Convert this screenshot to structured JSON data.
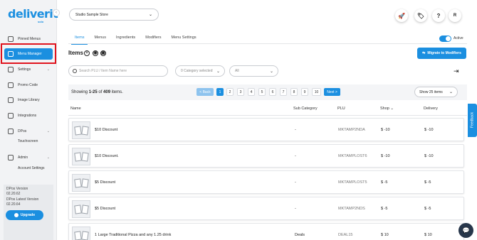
{
  "brand": {
    "logo": "deliverit",
    "sub": "solo",
    "accent": "#1b8fe0"
  },
  "sidebar": {
    "items": [
      {
        "label": "Pinned Menus",
        "icon": "pin-icon"
      },
      {
        "label": "Menu Manager",
        "icon": "menu-icon"
      },
      {
        "label": "Settings",
        "icon": "gear-icon"
      },
      {
        "label": "Promo Code",
        "icon": "ticket-icon"
      },
      {
        "label": "Image Library",
        "icon": "image-icon"
      },
      {
        "label": "Integrations",
        "icon": "link-icon"
      },
      {
        "label": "DPos",
        "icon": "pos-icon"
      },
      {
        "label": "Admin",
        "icon": "user-icon"
      }
    ],
    "sub_touchscreen": "Touchscreen",
    "sub_account_settings": "Account Settings",
    "version": {
      "dpos_label": "DPos Version",
      "dpos_value": "02.20.62",
      "latest_label": "DPos Latest Version",
      "latest_value": "02.20.64"
    },
    "upgrade_label": "Upgrade"
  },
  "header": {
    "store": "Studio Sample Store",
    "buttons": [
      "rocket-icon",
      "tag-icon",
      "help-icon"
    ],
    "avatar": "R"
  },
  "tabs": [
    "Items",
    "Menus",
    "Ingredients",
    "Modifiers",
    "Menu Settings"
  ],
  "active_toggle_label": "Active",
  "items_title": "Items",
  "migrate_label": "Migrate to Modifiers",
  "filters": {
    "search_placeholder": "Search PLU / Item Name here",
    "category": "0 Category selected",
    "type": "All"
  },
  "pagination": {
    "showing_prefix": "Showing ",
    "range": "1-25",
    "of": " of ",
    "total": "409",
    "suffix": " items.",
    "back": "< Back",
    "pages": [
      "1",
      "2",
      "3",
      "4",
      "5",
      "6",
      "7",
      "8",
      "9",
      "10"
    ],
    "next": "Next >",
    "per_page": "Show 25 items"
  },
  "table": {
    "headers": {
      "name": "Name",
      "sub_category": "Sub Category",
      "plu": "PLU",
      "shop": "Shop ⌄",
      "delivery": "Delivery"
    },
    "rows": [
      {
        "name": "$10 Discount",
        "sub": "-",
        "plu": "MKTAMP2NDA",
        "shop": "$ -10",
        "delivery": "$ -10"
      },
      {
        "name": "$10 Discount.",
        "sub": "-",
        "plu": "MKTAMPLOST6",
        "shop": "$ -10",
        "delivery": "$ -10"
      },
      {
        "name": "$5 Discount",
        "sub": "-",
        "plu": "MKTAMPLOST5",
        "shop": "$ -5",
        "delivery": "$ -5"
      },
      {
        "name": "$5 Discount",
        "sub": "-",
        "plu": "MKTAMP2NDS",
        "shop": "$ -5",
        "delivery": "$ -5"
      },
      {
        "name": "1 Large Traditional Pizza and any 1.25 drink",
        "sub": "Deals",
        "plu": "DEAL15",
        "shop": "$ 10",
        "delivery": "$ 10"
      }
    ]
  },
  "feedback_label": "Feedback"
}
